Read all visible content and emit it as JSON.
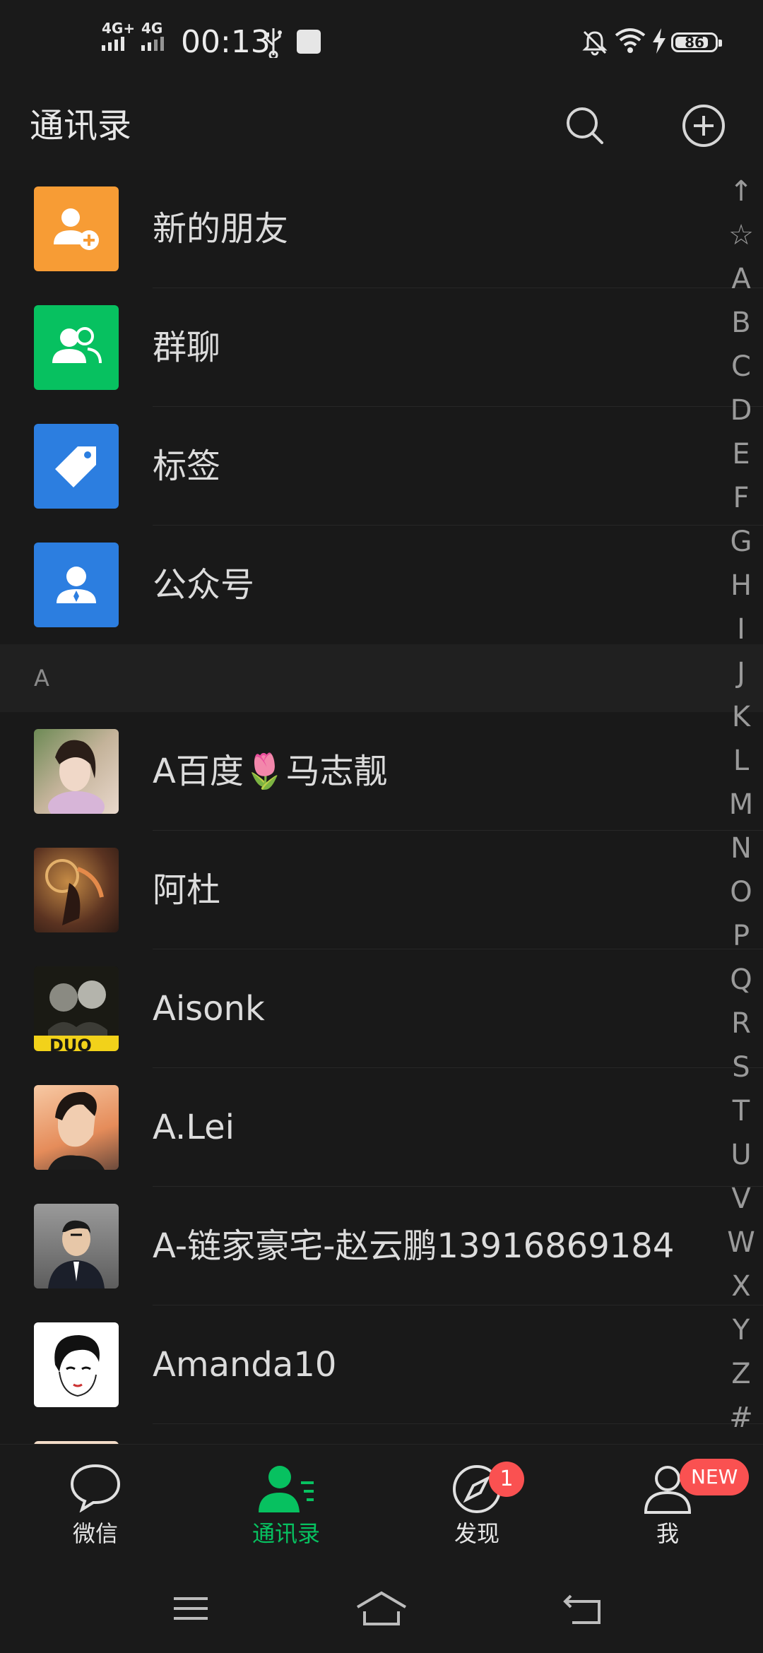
{
  "status_bar": {
    "signal1_label": "4G+",
    "signal2_label": "4G",
    "time": "00:13",
    "battery_percent": "86",
    "battery_level": 0.86
  },
  "header": {
    "title": "通讯录"
  },
  "colors": {
    "accent": "#07c160",
    "new_friends": "#f79c35",
    "group_chat": "#07c160",
    "tags": "#2c7ee0",
    "official_accounts": "#2c7ee0",
    "badge": "#fa5151"
  },
  "function_items": [
    {
      "label": "新的朋友",
      "icon": "add-friend-icon"
    },
    {
      "label": "群聊",
      "icon": "group-chat-icon"
    },
    {
      "label": "标签",
      "icon": "tag-icon"
    },
    {
      "label": "公众号",
      "icon": "official-account-icon"
    }
  ],
  "section": {
    "letter": "A"
  },
  "contacts": [
    {
      "name": "A百度🌷马志靓"
    },
    {
      "name": "阿杜"
    },
    {
      "name": "Aisonk"
    },
    {
      "name": "A.Lei"
    },
    {
      "name": "A-链家豪宅-赵云鹏13916869184"
    },
    {
      "name": "Amanda10"
    }
  ],
  "index_bar": [
    "↑",
    "☆",
    "A",
    "B",
    "C",
    "D",
    "E",
    "F",
    "G",
    "H",
    "I",
    "J",
    "K",
    "L",
    "M",
    "N",
    "O",
    "P",
    "Q",
    "R",
    "S",
    "T",
    "U",
    "V",
    "W",
    "X",
    "Y",
    "Z",
    "#"
  ],
  "tabs": [
    {
      "label": "微信",
      "icon": "chat-bubble-icon"
    },
    {
      "label": "通讯录",
      "icon": "contacts-icon",
      "active": true
    },
    {
      "label": "发现",
      "icon": "compass-icon",
      "badge": "1"
    },
    {
      "label": "我",
      "icon": "person-icon",
      "badge": "NEW"
    }
  ]
}
